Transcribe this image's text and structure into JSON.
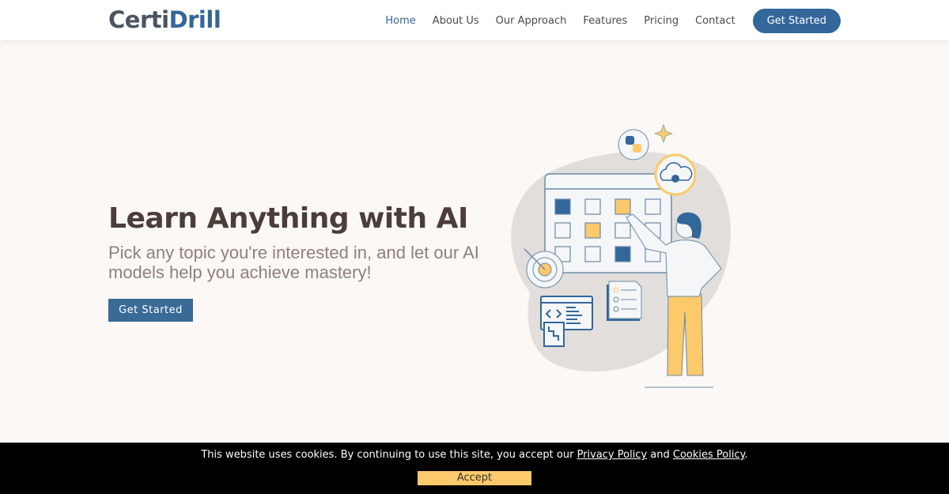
{
  "brand": {
    "part1": "Certi",
    "part2": "Drill"
  },
  "nav": {
    "items": [
      {
        "label": "Home"
      },
      {
        "label": "About Us"
      },
      {
        "label": "Our Approach"
      },
      {
        "label": "Features"
      },
      {
        "label": "Pricing"
      },
      {
        "label": "Contact"
      }
    ],
    "cta": "Get Started"
  },
  "hero": {
    "title": "Learn Anything with AI",
    "subtitle": "Pick any topic you're interested in, and let our AI models help you achieve mastery!",
    "button": "Get Started"
  },
  "cookie": {
    "text": "This website uses cookies. By continuing to use this site, you accept our ",
    "privacy": "Privacy Policy",
    "and": " and ",
    "cookies": "Cookies Policy",
    "end": ".",
    "accept": "Accept"
  },
  "colors": {
    "brand": "#336699",
    "accent": "#fcc96b",
    "heading": "#4a3d3a"
  }
}
